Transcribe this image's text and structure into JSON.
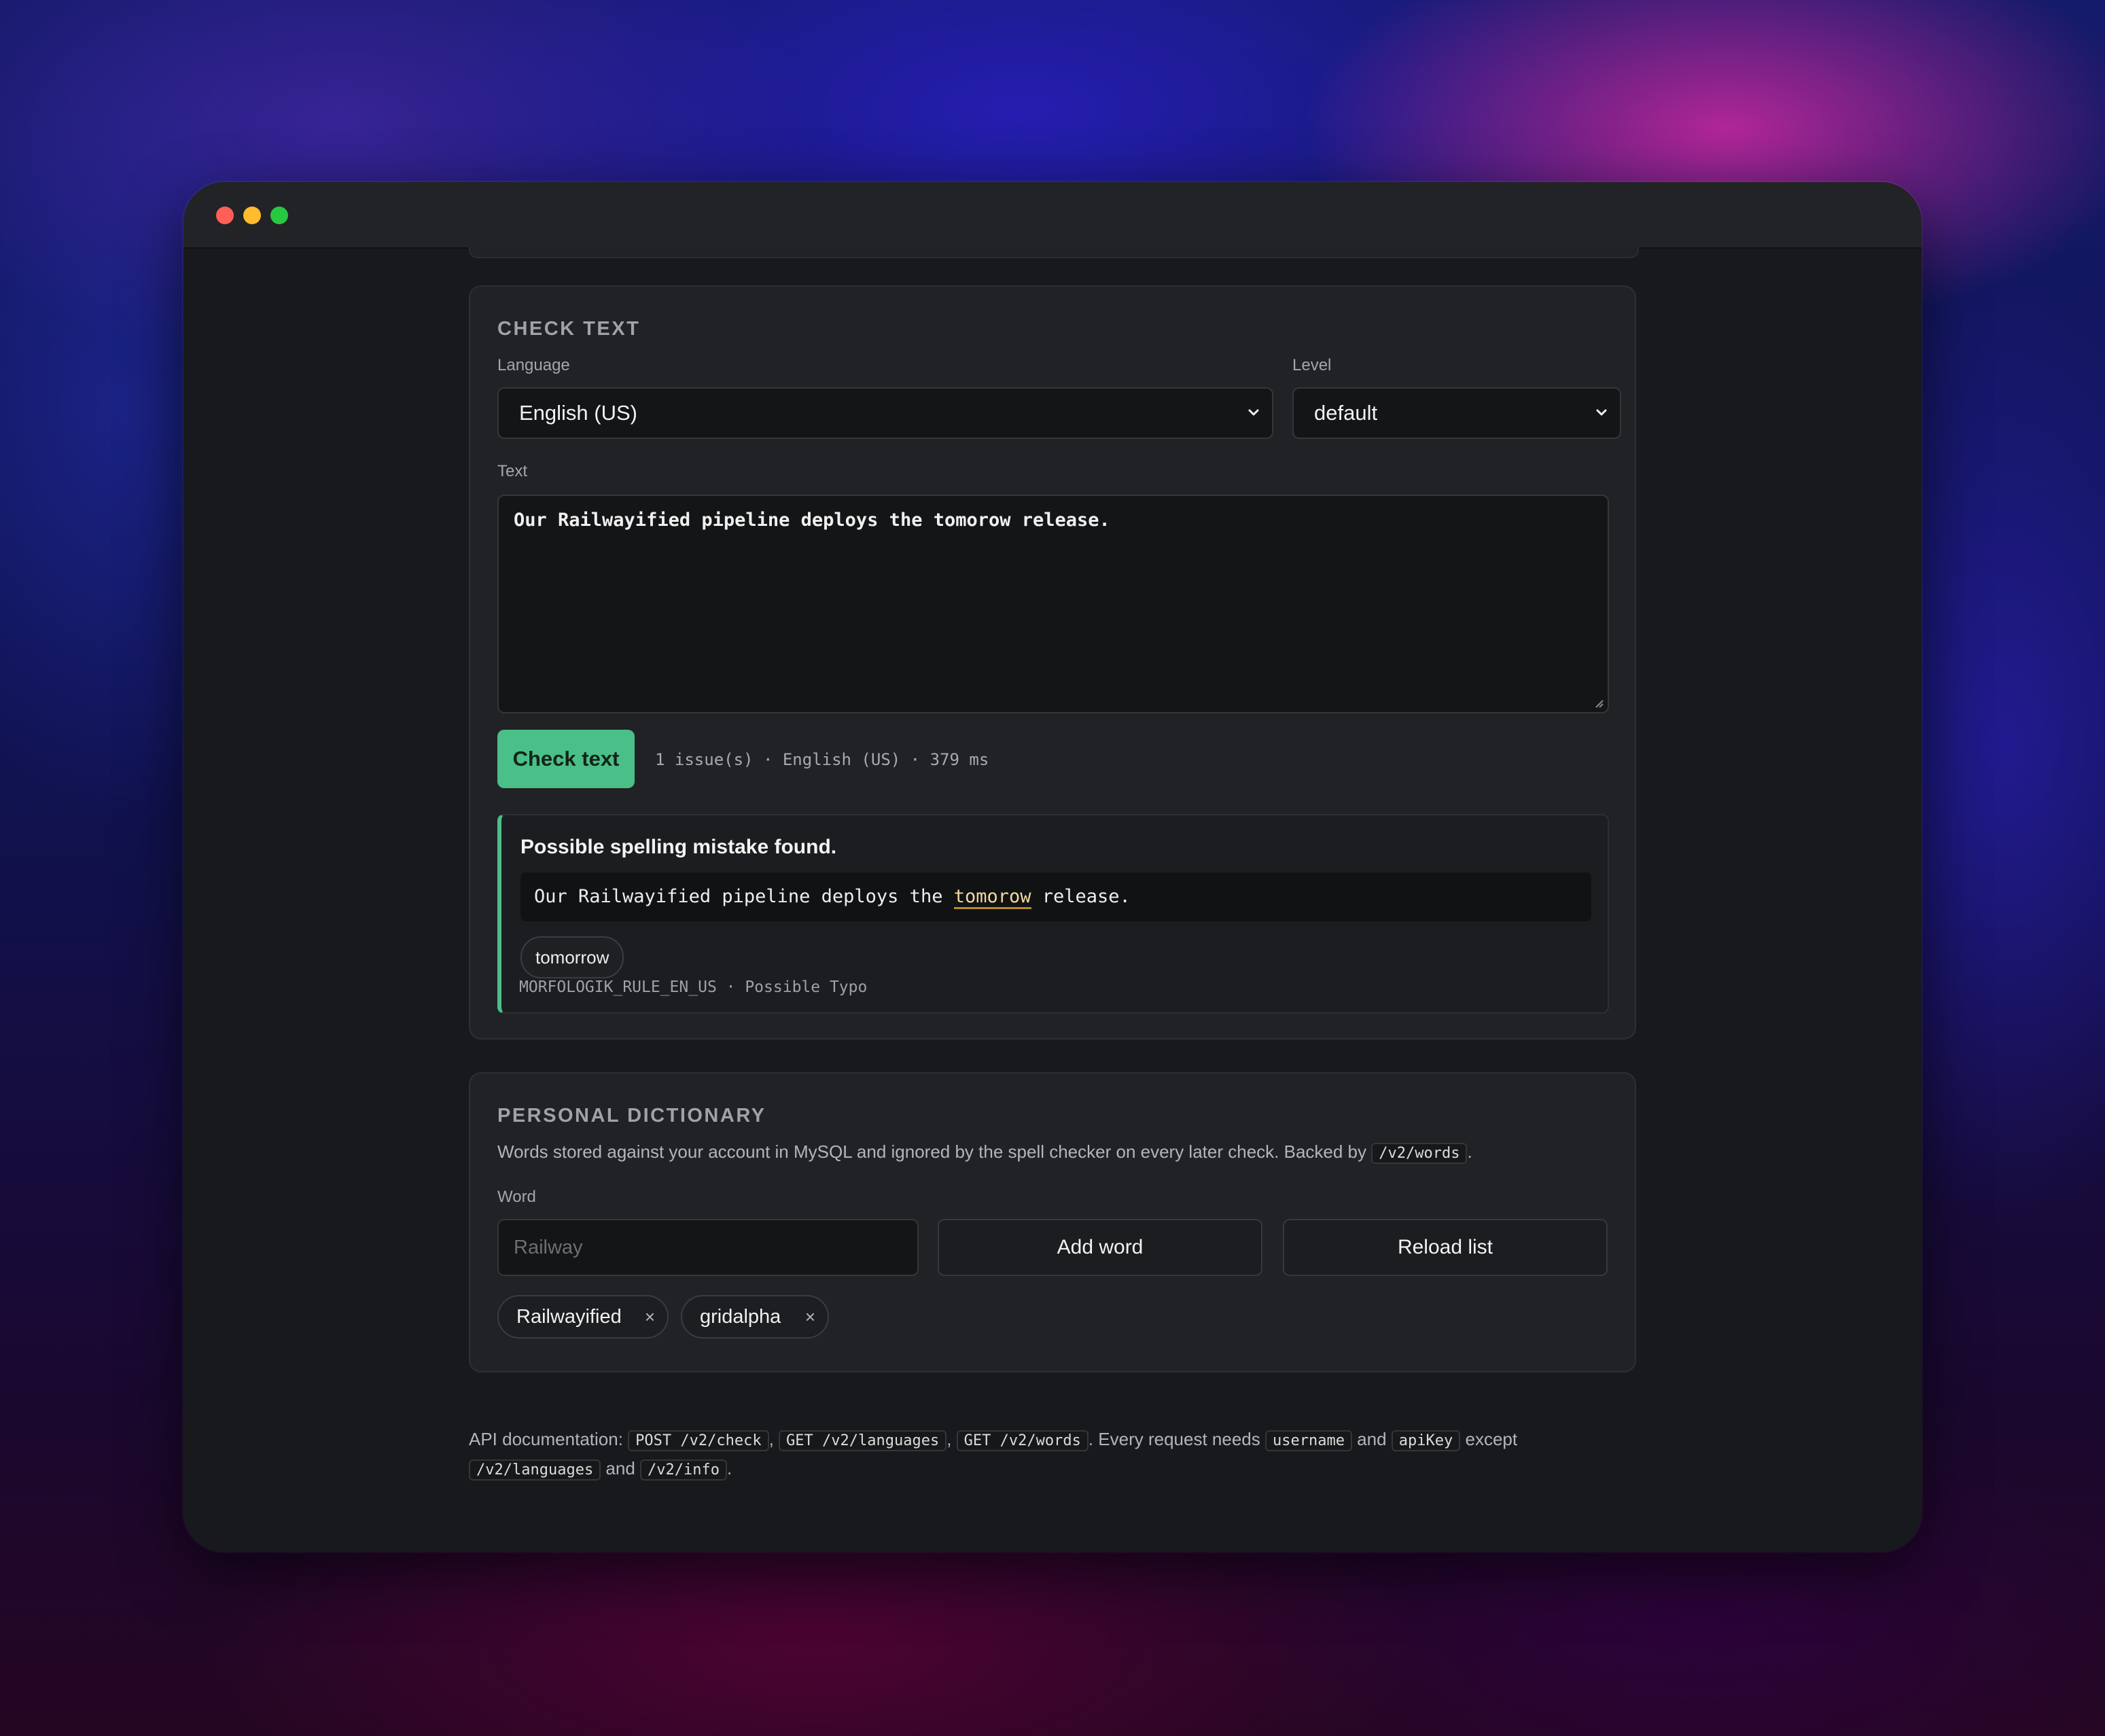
{
  "check_text": {
    "title": "CHECK TEXT",
    "language_label": "Language",
    "language_value": "English (US)",
    "level_label": "Level",
    "level_value": "default",
    "text_label": "Text",
    "text_value": "Our Railwayified pipeline deploys the tomorow release.",
    "button_label": "Check text",
    "status": "1 issue(s) · English (US) · 379 ms"
  },
  "issue": {
    "message": "Possible spelling mistake found.",
    "context_before": "Our Railwayified pipeline deploys the ",
    "context_error": "tomorow",
    "context_after": " release.",
    "suggestion": "tomorrow",
    "rule": "MORFOLOGIK_RULE_EN_US · Possible Typo"
  },
  "dictionary": {
    "title": "PERSONAL DICTIONARY",
    "description_before": "Words stored against your account in MySQL and ignored by the spell checker on every later check. Backed by ",
    "description_code": "/v2/words",
    "description_after": ".",
    "word_label": "Word",
    "word_placeholder": "Railway",
    "add_button": "Add word",
    "reload_button": "Reload list",
    "words": [
      "Railwayified",
      "gridalpha"
    ],
    "remove_glyph": "×"
  },
  "footer": {
    "prefix": "API documentation: ",
    "code1": "POST /v2/check",
    "sep1": ", ",
    "code2": "GET /v2/languages",
    "sep2": ", ",
    "code3": "GET /v2/words",
    "mid1": ". Every request needs ",
    "code4": "username",
    "mid2": " and ",
    "code5": "apiKey",
    "mid3": " except ",
    "code6": "/v2/languages",
    "mid4": " and ",
    "code7": "/v2/info",
    "end": "."
  },
  "colors": {
    "accent": "#4bbf88",
    "background": "#18191c",
    "card": "#212226",
    "close": "#fe5f57",
    "minimize": "#febc2e",
    "maximize": "#28c840"
  },
  "icons": {
    "select_arrow": "chevron-down-icon",
    "remove": "close-icon"
  }
}
